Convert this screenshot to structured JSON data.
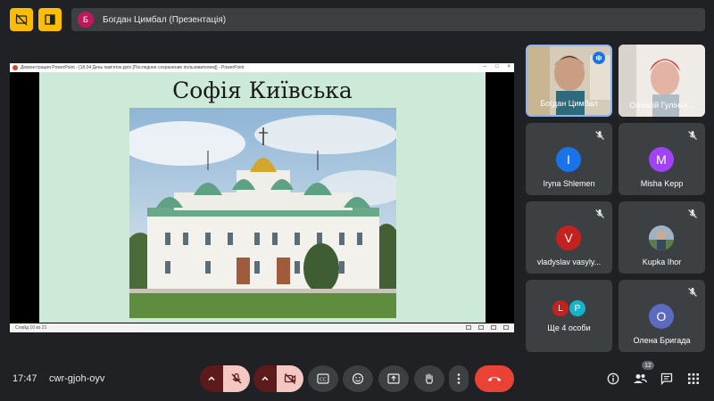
{
  "topbar": {
    "presenter_initial": "Б",
    "presenter_text": "Богдан Цимбал (Презентація)",
    "icons": [
      "captions-off-icon",
      "present-to-all-icon"
    ]
  },
  "presentation": {
    "window_title": "Демонстрация PowerPoint - [18.04 День пам'яток.pptx [Последнее сохранение пользователем]] - PowerPoint",
    "slide_title": "Софія Київська",
    "status_text": "Слайд 10 из 21"
  },
  "participants": [
    {
      "name": "Богдан Цимбал",
      "type": "video",
      "speaking": true
    },
    {
      "name": "Олексій Гуліньк...",
      "type": "video",
      "speaking": false
    },
    {
      "name": "Iryna Shlemen",
      "initial": "I",
      "color": "#1a73e8",
      "muted": true
    },
    {
      "name": "Misha Kepp",
      "initial": "M",
      "color": "#a142f4",
      "muted": true
    },
    {
      "name": "vladyslav vasyly...",
      "initial": "V",
      "color": "#c5221f",
      "muted": true
    },
    {
      "name": "Kupka Ihor",
      "type": "photo",
      "muted": true
    },
    {
      "name": "Ще 4 особи",
      "initials": [
        "L",
        "P"
      ],
      "colors": [
        "#c5221f",
        "#12b5cb"
      ]
    },
    {
      "name": "Олена Бригада",
      "initial": "O",
      "color": "#5c6bc0",
      "muted": true
    }
  ],
  "bottombar": {
    "time": "17:47",
    "meeting_code": "cwr-gjoh-oyv",
    "people_count": "12"
  }
}
